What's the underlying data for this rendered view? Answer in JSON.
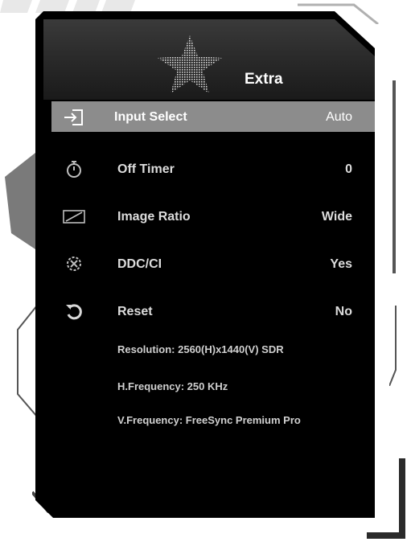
{
  "header": {
    "title": "Extra",
    "icon": "star-icon"
  },
  "menu": {
    "items": [
      {
        "icon": "input-select-icon",
        "label": "Input Select",
        "value": "Auto"
      },
      {
        "icon": "timer-icon",
        "label": "Off Timer",
        "value": "0"
      },
      {
        "icon": "image-ratio-icon",
        "label": "Image Ratio",
        "value": "Wide"
      },
      {
        "icon": "ddc-ci-icon",
        "label": "DDC/CI",
        "value": "Yes"
      },
      {
        "icon": "reset-icon",
        "label": "Reset",
        "value": "No"
      }
    ]
  },
  "info": {
    "resolution": "Resolution: 2560(H)x1440(V) SDR",
    "h_frequency": "H.Frequency: 250 KHz",
    "v_frequency": "V.Frequency: FreeSync Premium Pro"
  },
  "colors": {
    "panel_bg": "#000000",
    "selected_row_bg": "#8c8c8c",
    "text": "#dcdcdc"
  }
}
